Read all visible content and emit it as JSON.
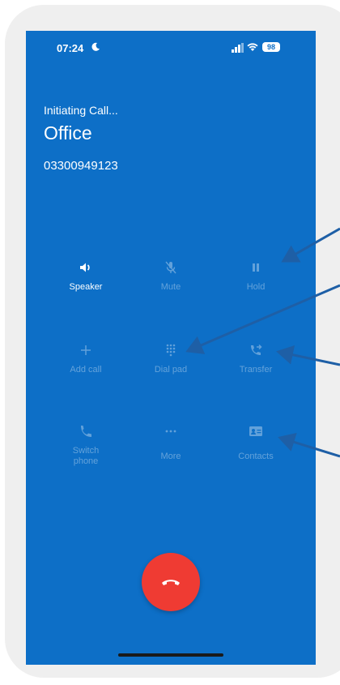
{
  "status_bar": {
    "time": "07:24",
    "moon_icon": "moon-icon",
    "signal_icon": "signal-icon",
    "wifi_icon": "wifi-icon",
    "battery": "98"
  },
  "call": {
    "status": "Initiating Call...",
    "name": "Office",
    "number": "03300949123"
  },
  "controls": [
    {
      "label": "Speaker",
      "icon": "speaker-icon",
      "enabled": true
    },
    {
      "label": "Mute",
      "icon": "mic-off-icon",
      "enabled": false
    },
    {
      "label": "Hold",
      "icon": "pause-icon",
      "enabled": false
    },
    {
      "label": "Add call",
      "icon": "plus-icon",
      "enabled": false
    },
    {
      "label": "Dial pad",
      "icon": "dialpad-icon",
      "enabled": false
    },
    {
      "label": "Transfer",
      "icon": "transfer-icon",
      "enabled": false
    },
    {
      "label": "Switch phone",
      "icon": "phone-icon",
      "enabled": false
    },
    {
      "label": "More",
      "icon": "more-icon",
      "enabled": false
    },
    {
      "label": "Contacts",
      "icon": "contacts-icon",
      "enabled": false
    }
  ],
  "end_call": {
    "icon": "end-call-icon"
  },
  "colors": {
    "background": "#0d6fc7",
    "end_call": "#ef3b33",
    "frame": "#efefef",
    "annotation_arrow": "#1e5fa6"
  }
}
